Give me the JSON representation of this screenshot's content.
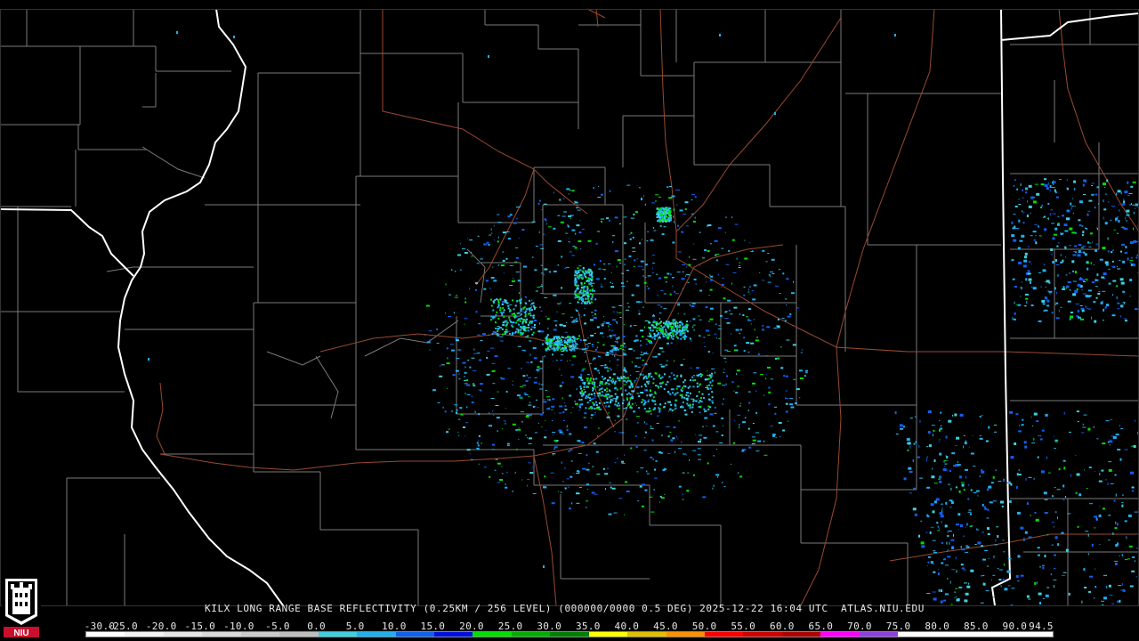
{
  "product": {
    "radar_site": "KILX",
    "caption": "KILX LONG RANGE BASE REFLECTIVITY (0.25KM / 256 LEVEL) (000000/0000 0.5 DEG) 2025-12-22 16:04 UTC  ATLAS.NIU.EDU",
    "timestamp": "2025-12-22 16:04 UTC",
    "source": "ATLAS.NIU.EDU"
  },
  "logo": {
    "text": "NIU"
  },
  "scale": {
    "labels": [
      "-30.0",
      "-25.0",
      "-20.0",
      "-15.0",
      "-10.0",
      "-5.0",
      "0.0",
      "5.0",
      "10.0",
      "15.0",
      "20.0",
      "25.0",
      "30.0",
      "35.0",
      "40.0",
      "45.0",
      "50.0",
      "55.0",
      "60.0",
      "65.0",
      "70.0",
      "75.0",
      "80.0",
      "85.0",
      "90.0",
      "94.5"
    ],
    "colors": [
      "#ffffff",
      "#f2f2f2",
      "#e6e6e6",
      "#d9d9d9",
      "#cccccc",
      "#bfbfbf",
      "#3fd0e0",
      "#1fb0f0",
      "#1060f0",
      "#0010e0",
      "#00e000",
      "#00b000",
      "#008000",
      "#ffff00",
      "#e0c000",
      "#ff9000",
      "#ff0000",
      "#d00000",
      "#b00000",
      "#ff00ff",
      "#9040e0",
      "#ffffff",
      "#ffffff",
      "#ffffff",
      "#ffffff"
    ]
  },
  "colors": {
    "background": "#000000",
    "county_lines": "#7a7a7a",
    "state_lines": "#ffffff",
    "highways": "#9a4a30"
  }
}
